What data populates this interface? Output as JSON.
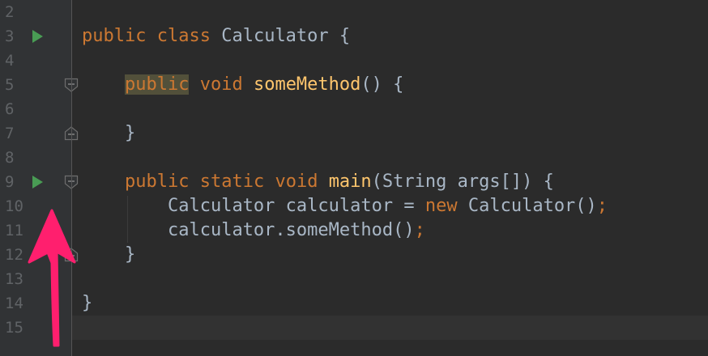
{
  "editor": {
    "line_numbers": [
      "2",
      "3",
      "4",
      "5",
      "6",
      "7",
      "8",
      "9",
      "10",
      "11",
      "12",
      "13",
      "14",
      "15"
    ],
    "lines": {
      "l3": {
        "t1": "public",
        "t2": " ",
        "t3": "class",
        "t4": " Calculator {"
      },
      "l5": {
        "indent": "    ",
        "t1": "public",
        "t2": " ",
        "t3": "void",
        "t4": " ",
        "t5": "someMethod",
        "t6": "() {"
      },
      "l7": {
        "indent": "    ",
        "t1": "}"
      },
      "l9": {
        "indent": "    ",
        "t1": "public",
        "t2": " ",
        "t3": "static",
        "t4": " ",
        "t5": "void",
        "t6": " ",
        "t7": "main",
        "t8": "(String args[]) {"
      },
      "l10": {
        "indent": "        ",
        "t1": "Calculator calculator = ",
        "t2": "new",
        "t3": " Calculator()",
        "t4": ";"
      },
      "l11": {
        "indent": "        ",
        "t1": "calculator.someMethod()",
        "t2": ";"
      },
      "l12": {
        "indent": "    ",
        "t1": "}"
      },
      "l14": {
        "t1": "}"
      }
    },
    "icons": {
      "run": "play-triangle-icon",
      "fold_start": "fold-start-icon",
      "fold_end": "fold-end-icon",
      "annotation": "pink-arrow-up"
    },
    "colors": {
      "background": "#2b2b2b",
      "gutter": "#313335",
      "keyword": "#cc7832",
      "method": "#ffc66d",
      "text": "#a9b7c6",
      "line_number": "#606366",
      "run_icon": "#499c54",
      "annotation_arrow": "#ff1f6e"
    }
  }
}
